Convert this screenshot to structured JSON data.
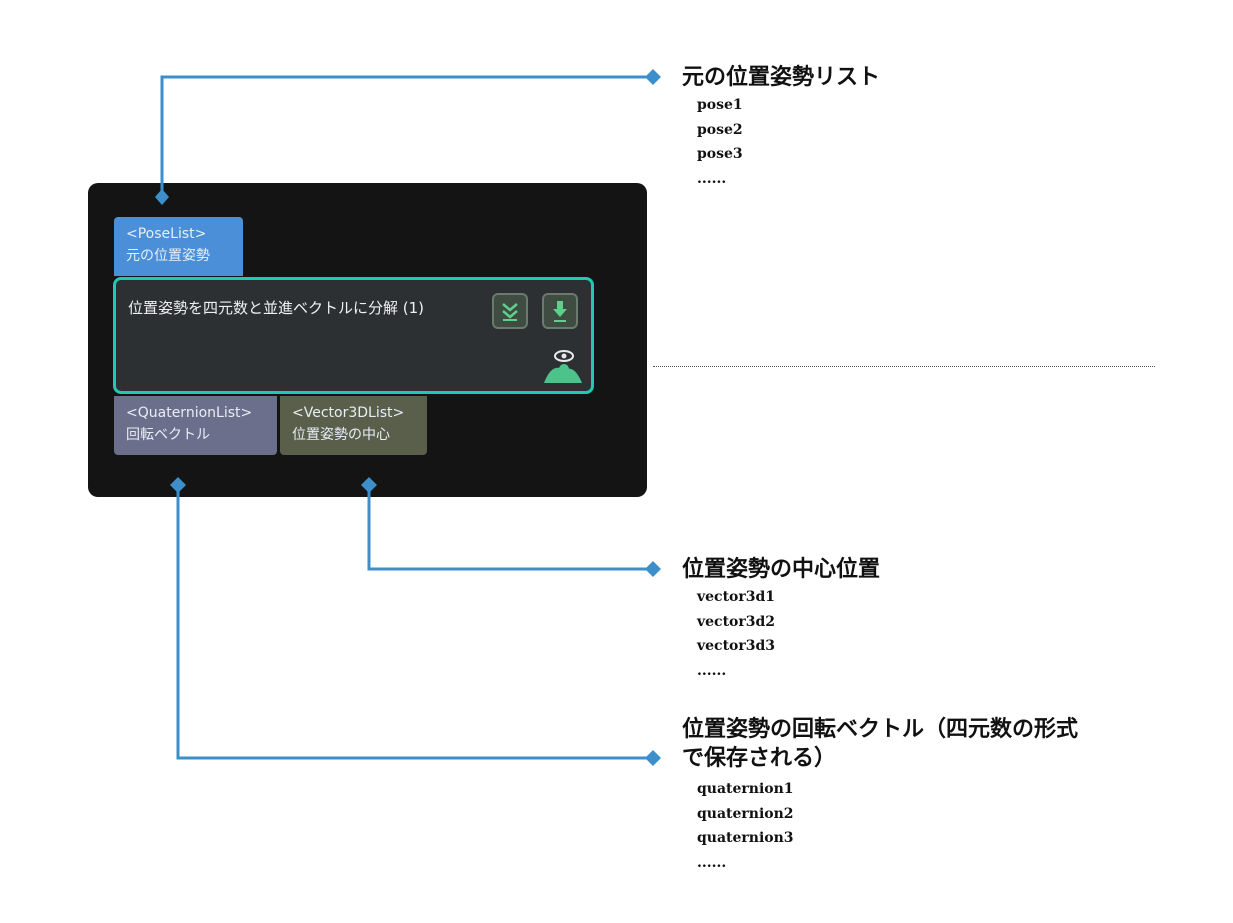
{
  "node": {
    "title": "位置姿勢を四元数と並進ベクトルに分解 (1)",
    "input_port": {
      "type": "<PoseList>",
      "label": "元の位置姿勢"
    },
    "output_ports": [
      {
        "type": "<QuaternionList>",
        "label": "回転ベクトル"
      },
      {
        "type": "<Vector3DList>",
        "label": "位置姿勢の中心"
      }
    ],
    "icons": [
      "double-chevron-down-icon",
      "download-icon",
      "eye-visibility-icon"
    ]
  },
  "annotations": [
    {
      "heading": "元の位置姿勢リスト",
      "items": [
        "pose1",
        "pose2",
        "pose3",
        "......"
      ]
    },
    {
      "heading": "位置姿勢の中心位置",
      "items": [
        "vector3d1",
        "vector3d2",
        "vector3d3",
        "......"
      ]
    },
    {
      "heading_lines": [
        "位置姿勢の回転ベクトル（四元数の形式",
        "で保存される）"
      ],
      "items": [
        "quaternion1",
        "quaternion2",
        "quaternion3",
        "......"
      ]
    }
  ],
  "colors": {
    "connector": "#3d8fcc",
    "node_background": "#141414",
    "node_border": "#1fc9b2",
    "input_port": "#4a8fd8",
    "quaternion_port": "#6c6f8c",
    "vector_port": "#5a5f4c"
  }
}
